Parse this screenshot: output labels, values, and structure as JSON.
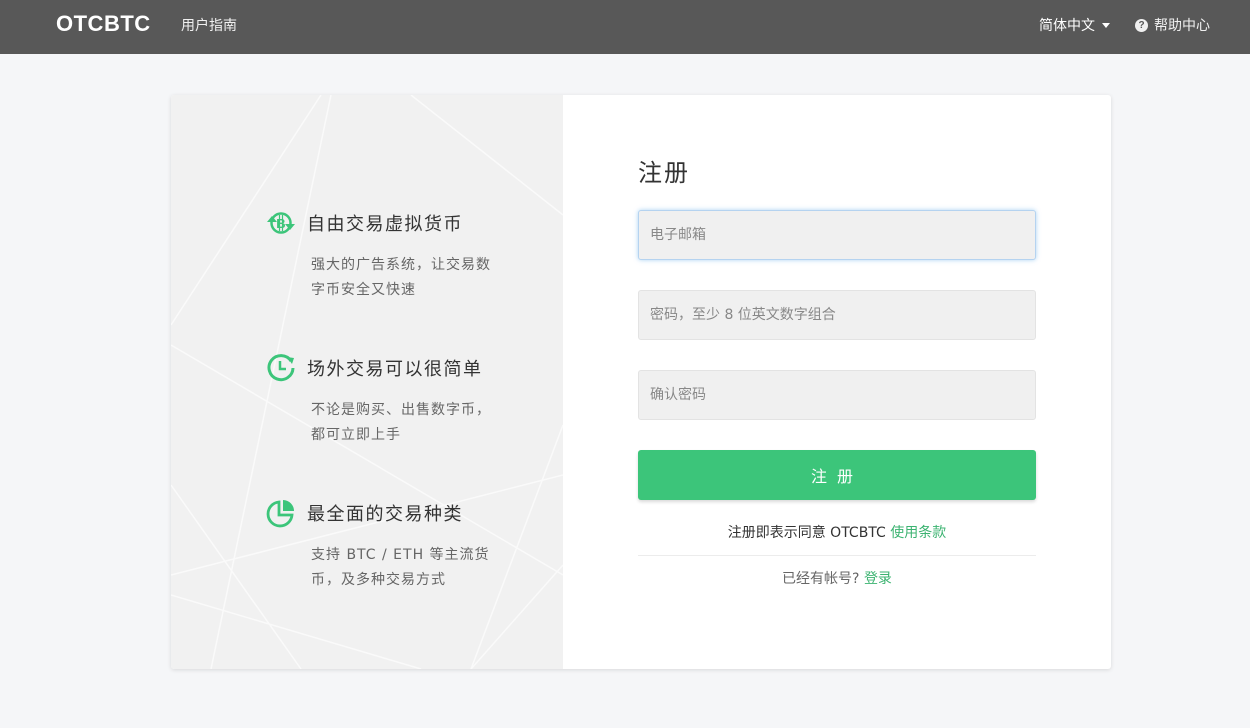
{
  "header": {
    "brand": "OTCBTC",
    "nav_guide": "用户指南",
    "language": "简体中文",
    "help_label": "帮助中心",
    "help_icon_glyph": "?"
  },
  "features": [
    {
      "icon": "bitcoin-exchange-icon",
      "title": "自由交易虚拟货币",
      "desc_line1": "强大的广告系统，让交易数",
      "desc_line2": "字币安全又快速"
    },
    {
      "icon": "clock-cycle-icon",
      "title": "场外交易可以很简单",
      "desc_line1": "不论是购买、出售数字币，",
      "desc_line2": "都可立即上手"
    },
    {
      "icon": "pie-chart-icon",
      "title": "最全面的交易种类",
      "desc_line1": "支持 BTC / ETH 等主流货",
      "desc_line2": "币，及多种交易方式"
    }
  ],
  "form": {
    "title": "注册",
    "email_placeholder": "电子邮箱",
    "password_placeholder": "密码，至少 8 位英文数字组合",
    "confirm_placeholder": "确认密码",
    "submit_label": "注册",
    "terms_prefix": "注册即表示同意 OTCBTC ",
    "terms_link": "使用条款",
    "login_prefix": "已经有帐号? ",
    "login_link": "登录"
  },
  "colors": {
    "accent": "#3cc57a",
    "header_bg": "#585858",
    "page_bg": "#f5f6f8"
  }
}
